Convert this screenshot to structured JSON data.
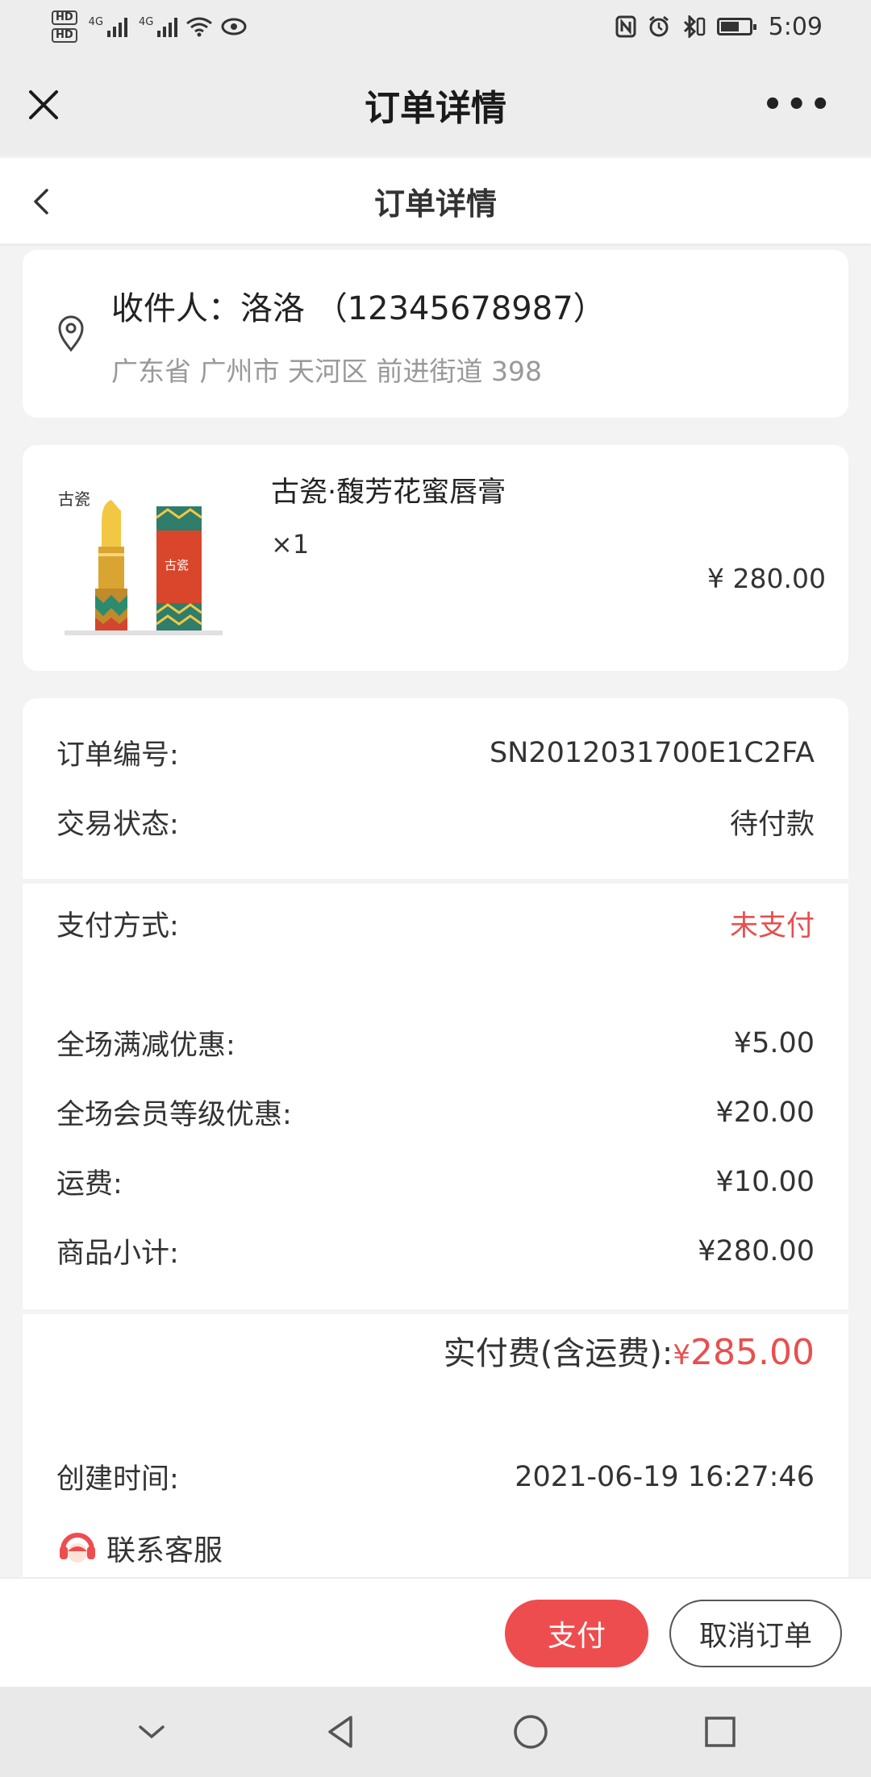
{
  "status_bar": {
    "hd1": "HD",
    "hd2": "HD",
    "net1": "4G",
    "net2": "4G",
    "time": "5:09",
    "icons": [
      "nfc-icon",
      "alarm-icon",
      "bluetooth-icon",
      "battery-icon"
    ]
  },
  "wechat_bar": {
    "title": "订单详情",
    "close_icon": "close-icon",
    "more_label": "•••"
  },
  "page_header": {
    "title": "订单详情",
    "back_icon": "chevron-left-icon"
  },
  "address": {
    "recipient": "收件人：洛洛 （12345678987）",
    "detail": "广东省 广州市 天河区 前进街道 398",
    "icon": "location-pin-icon"
  },
  "product": {
    "name": "古瓷·馥芳花蜜唇膏",
    "quantity": "×1",
    "price": "¥ 280.00",
    "image": "lipstick-product-image"
  },
  "order_info": {
    "order_no_label": "订单编号:",
    "order_no": "SN2012031700E1C2FA",
    "status_label": "交易状态:",
    "status": "待付款",
    "pay_method_label": "支付方式:",
    "pay_method": "未支付",
    "discount_label": "全场满减优惠:",
    "discount": "¥5.00",
    "member_discount_label": "全场会员等级优惠:",
    "member_discount": "¥20.00",
    "shipping_label": "运费:",
    "shipping": "¥10.00",
    "subtotal_label": "商品小计:",
    "subtotal": "¥280.00",
    "total_label": "实付费(含运费): ",
    "total_currency": "¥",
    "total_value": "285.00",
    "created_label": "创建时间:",
    "created": "2021-06-19 16:27:46",
    "service_label": "联系客服"
  },
  "actions": {
    "pay": "支付",
    "cancel": "取消订单"
  },
  "colors": {
    "accent_red": "#e84f4f",
    "pay_button": "#ee4d4f"
  },
  "nav": [
    "collapse-icon",
    "back-triangle-icon",
    "home-circle-icon",
    "recents-square-icon"
  ]
}
